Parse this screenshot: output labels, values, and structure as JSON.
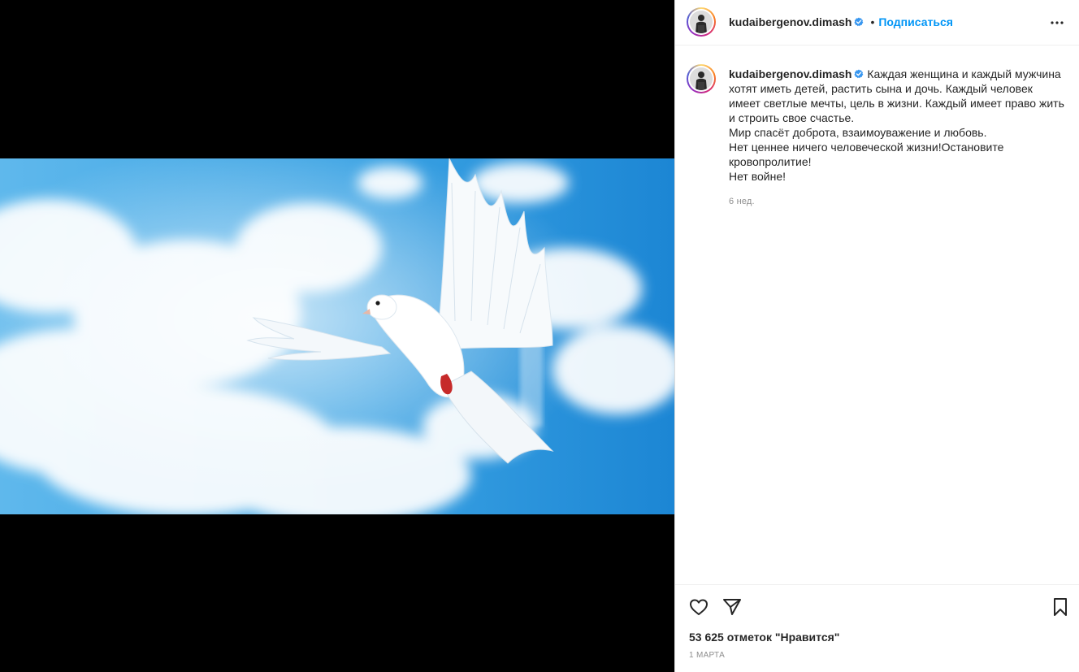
{
  "post": {
    "username": "kudaibergenov.dimash",
    "separator": "•",
    "follow_label": "Подписаться",
    "caption_lines": [
      "Каждая женщина и каждый мужчина хотят иметь детей, растить сына и дочь. Каждый человек имеет светлые мечты, цель в жизни. Каждый имеет право жить и строить свое счастье.",
      "Мир спасёт  доброта, взаимоуважение и любовь.",
      "Нет ценнее ничего человеческой жизни!Остановите кровопролитие!",
      "Нет войне!"
    ],
    "time_ago": "6 нед.",
    "likes_text": "53 625 отметок \"Нравится\"",
    "date": "1 марта"
  },
  "icons": {
    "verified": "verified-badge-icon",
    "more": "more-options-icon",
    "like": "heart-icon",
    "share": "send-icon",
    "save": "bookmark-icon"
  },
  "colors": {
    "accent": "#0095f6",
    "verified": "#3897f0",
    "text": "#262626",
    "secondary": "#8e8e8e",
    "media_background": "#000000",
    "sky": "#2f9be0"
  }
}
